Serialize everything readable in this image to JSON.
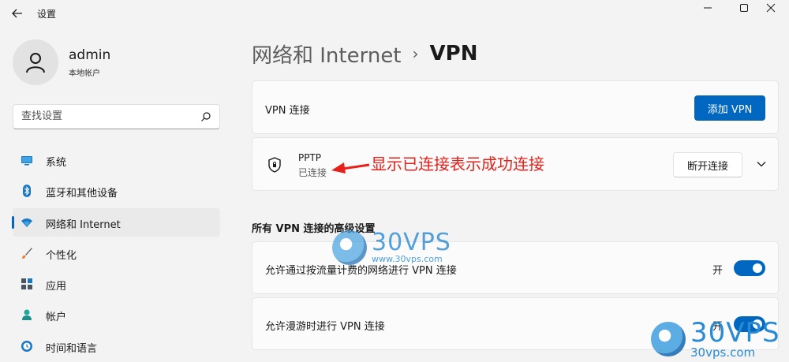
{
  "window": {
    "title": "设置",
    "controls": [
      "minimize",
      "maximize",
      "close"
    ]
  },
  "profile": {
    "name": "admin",
    "account_type": "本地帐户"
  },
  "search": {
    "placeholder": "查找设置"
  },
  "sidebar": {
    "items": [
      {
        "label": "系统",
        "icon": "monitor-icon",
        "active": false
      },
      {
        "label": "蓝牙和其他设备",
        "icon": "bluetooth-icon",
        "active": false
      },
      {
        "label": "网络和 Internet",
        "icon": "wifi-icon",
        "active": true
      },
      {
        "label": "个性化",
        "icon": "brush-icon",
        "active": false
      },
      {
        "label": "应用",
        "icon": "apps-icon",
        "active": false
      },
      {
        "label": "帐户",
        "icon": "person-icon",
        "active": false
      },
      {
        "label": "时间和语言",
        "icon": "globe-clock-icon",
        "active": false
      }
    ]
  },
  "breadcrumb": {
    "parent": "网络和 Internet",
    "separator": "›",
    "current": "VPN"
  },
  "vpn_card": {
    "label": "VPN 连接",
    "add_button": "添加 VPN"
  },
  "connection": {
    "name": "PPTP",
    "status": "已连接",
    "disconnect_button": "断开连接"
  },
  "annotation": {
    "text": "显示已连接表示成功连接",
    "color": "#e8201a"
  },
  "advanced": {
    "title": "所有 VPN 连接的高级设置",
    "settings": [
      {
        "label": "允许通过按流量计费的网络进行 VPN 连接",
        "state_label": "开",
        "on": true
      },
      {
        "label": "允许漫游时进行 VPN 连接",
        "state_label": "开",
        "on": true
      }
    ]
  },
  "watermark": {
    "brand": "30VPS",
    "url_small": "www.30vps.com",
    "url_large": "30vps.com"
  },
  "colors": {
    "accent": "#0067c0",
    "background": "#f3f3f3",
    "card": "#fbfbfb"
  }
}
